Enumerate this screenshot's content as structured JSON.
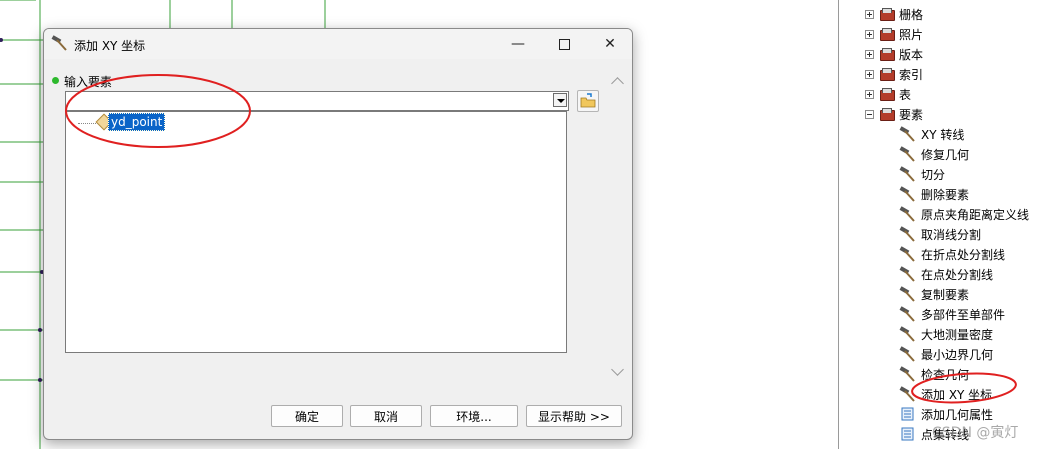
{
  "dialog": {
    "title": "添加 XY 坐标",
    "section_label": "输入要素",
    "combo_value": "",
    "list_items": [
      "yd_point"
    ],
    "buttons": {
      "ok": "确定",
      "cancel": "取消",
      "environments": "环境...",
      "show_help": "显示帮助 >>"
    }
  },
  "toolbox": {
    "categories": [
      "栅格",
      "照片",
      "版本",
      "索引",
      "表",
      "要素"
    ],
    "tools": [
      "XY 转线",
      "修复几何",
      "切分",
      "删除要素",
      "原点夹角距离定义线",
      "取消线分割",
      "在折点处分割线",
      "在点处分割线",
      "复制要素",
      "多部件至单部件",
      "大地测量密度",
      "最小边界几何",
      "检查几何",
      "添加 XY 坐标"
    ],
    "script_tools": [
      "添加几何属性",
      "点集转线"
    ]
  },
  "watermark": "CSDN @寅灯",
  "colors": {
    "annotation": "#e02020",
    "selection": "#0a64c8",
    "map_line": "#3aa03a"
  }
}
